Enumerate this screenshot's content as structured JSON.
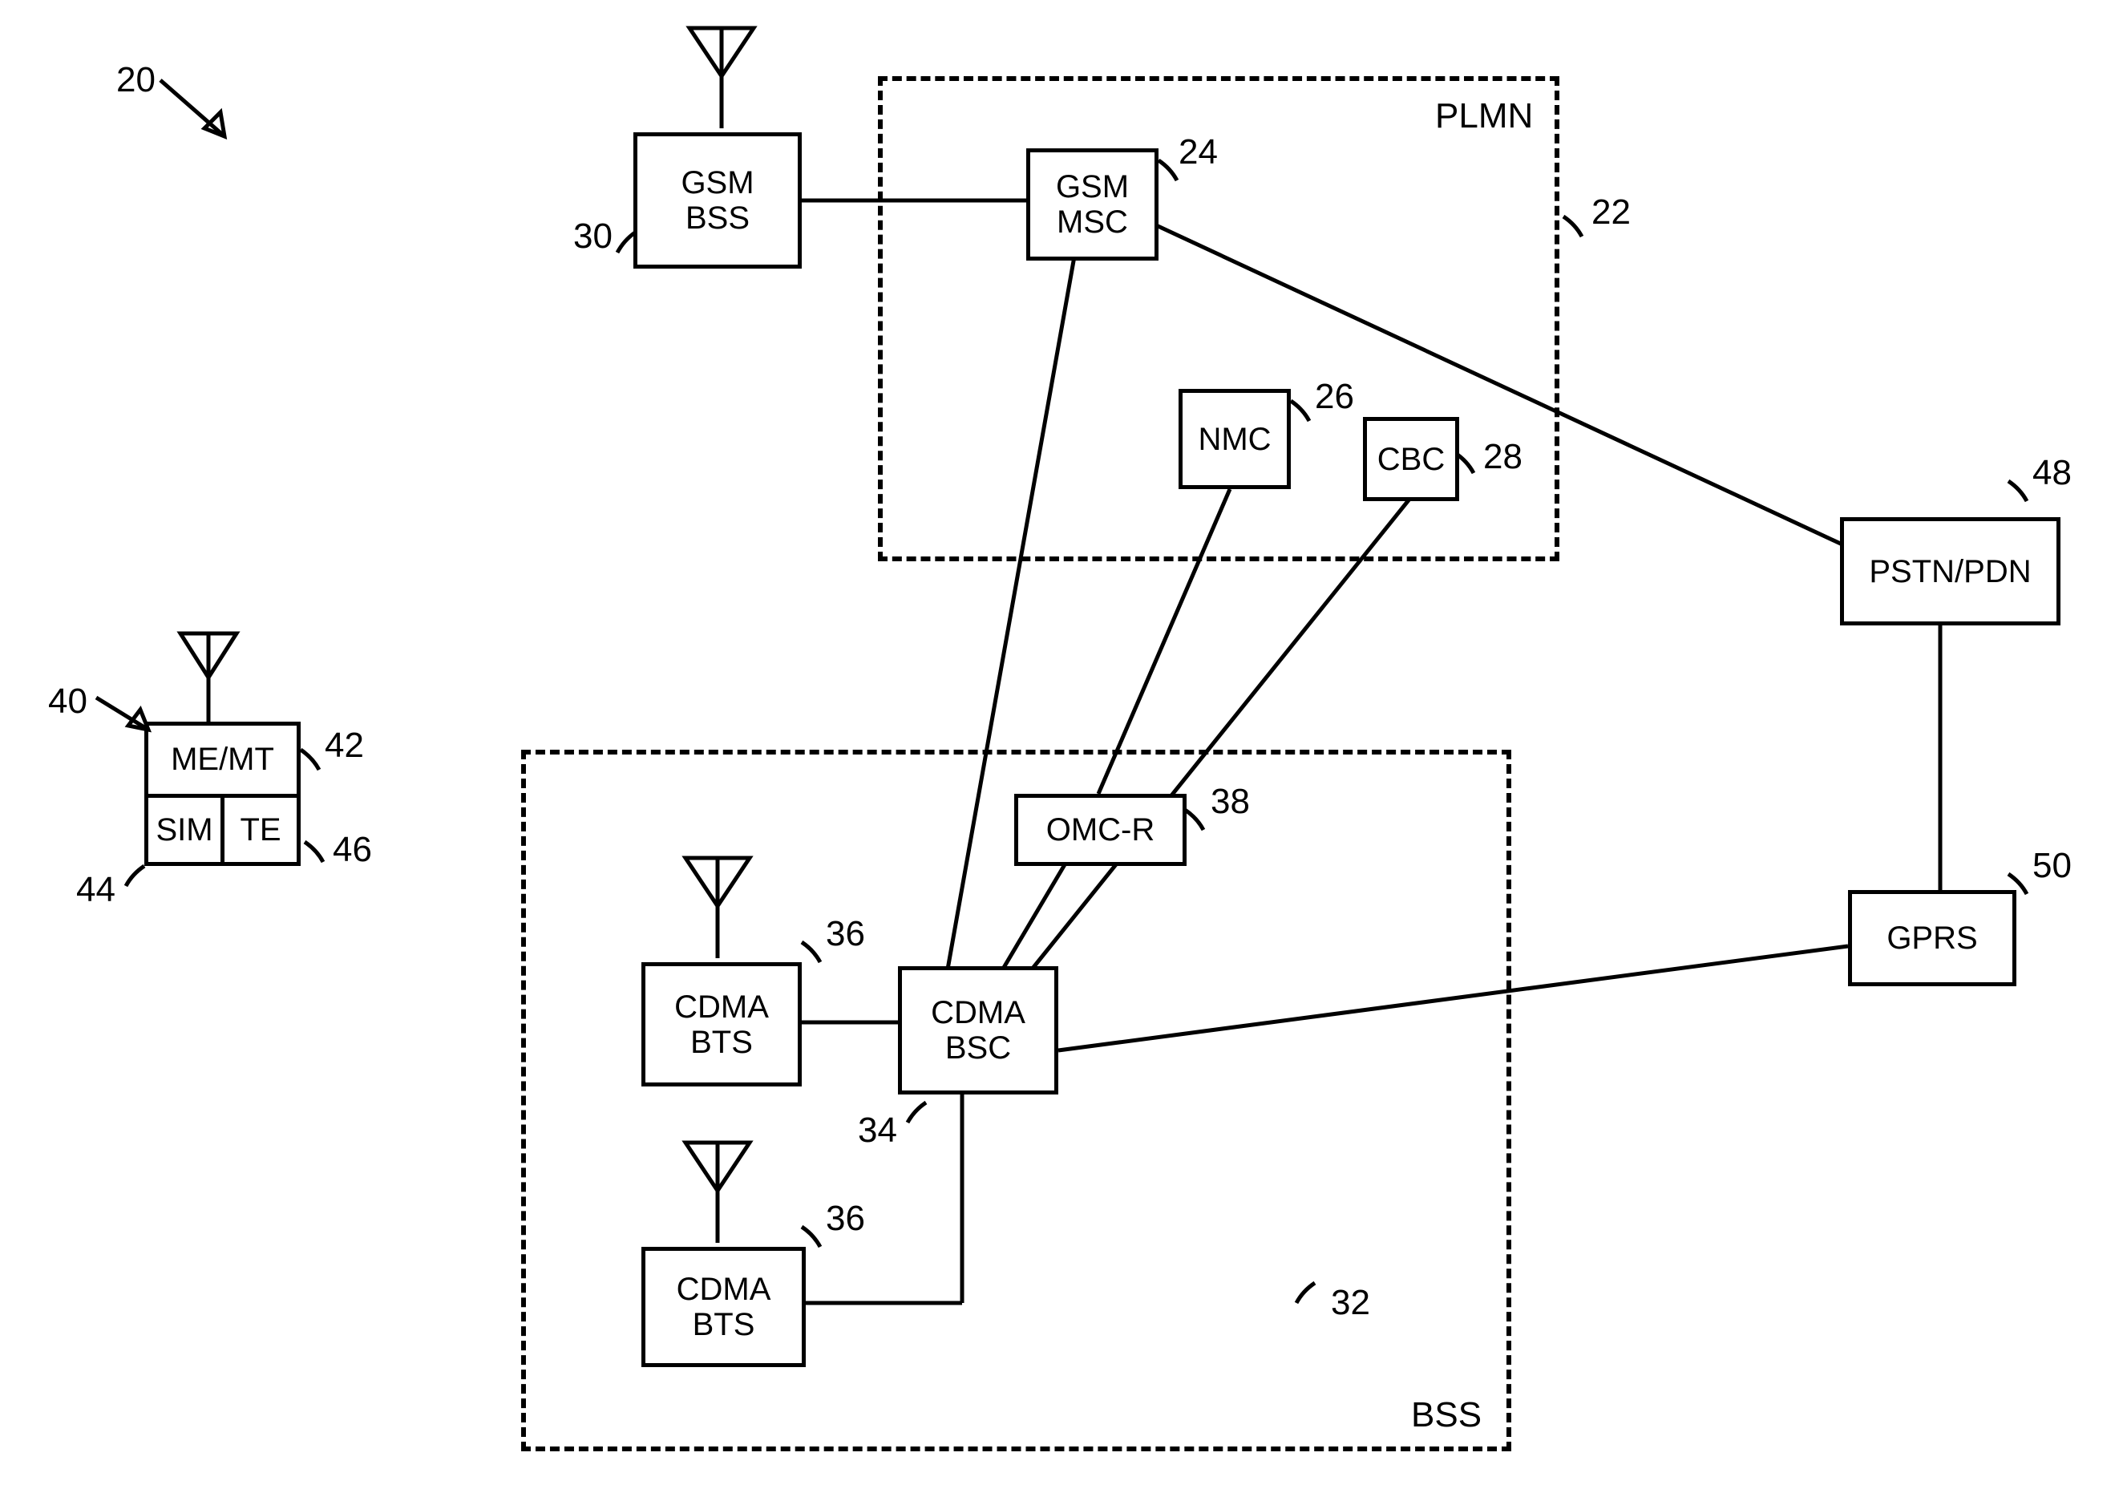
{
  "figure_ref": "20",
  "plmn": {
    "label": "PLMN",
    "ref": "22",
    "gsm_msc": {
      "label_line1": "GSM",
      "label_line2": "MSC",
      "ref": "24"
    },
    "nmc": {
      "label": "NMC",
      "ref": "26"
    },
    "cbc": {
      "label": "CBC",
      "ref": "28"
    }
  },
  "gsm_bss": {
    "label_line1": "GSM",
    "label_line2": "BSS",
    "ref": "30"
  },
  "bss": {
    "label": "BSS",
    "ref": "32",
    "cdma_bsc": {
      "label_line1": "CDMA",
      "label_line2": "BSC",
      "ref": "34"
    },
    "cdma_bts_1": {
      "label_line1": "CDMA",
      "label_line2": "BTS",
      "ref": "36"
    },
    "cdma_bts_2": {
      "label_line1": "CDMA",
      "label_line2": "BTS",
      "ref": "36"
    },
    "omc_r": {
      "label": "OMC-R",
      "ref": "38"
    }
  },
  "mobile": {
    "ref": "40",
    "me_mt": {
      "label": "ME/MT",
      "ref": "42"
    },
    "sim": {
      "label": "SIM",
      "ref": "44"
    },
    "te": {
      "label": "TE",
      "ref": "46"
    }
  },
  "pstn_pdn": {
    "label": "PSTN/PDN",
    "ref": "48"
  },
  "gprs": {
    "label": "GPRS",
    "ref": "50"
  }
}
